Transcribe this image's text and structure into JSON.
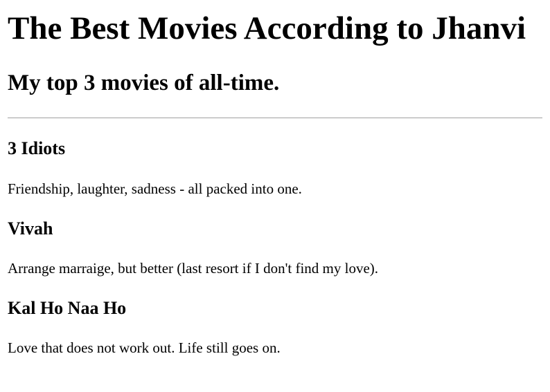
{
  "page": {
    "title": "The Best Movies According to Jhanvi",
    "subtitle": "My top 3 movies of all-time."
  },
  "movies": [
    {
      "title": "3 Idiots",
      "description": "Friendship, laughter, sadness - all packed into one."
    },
    {
      "title": "Vivah",
      "description": "Arrange marraige, but better (last resort if I don't find my love)."
    },
    {
      "title": "Kal Ho Naa Ho",
      "description": "Love that does not work out. Life still goes on."
    }
  ]
}
